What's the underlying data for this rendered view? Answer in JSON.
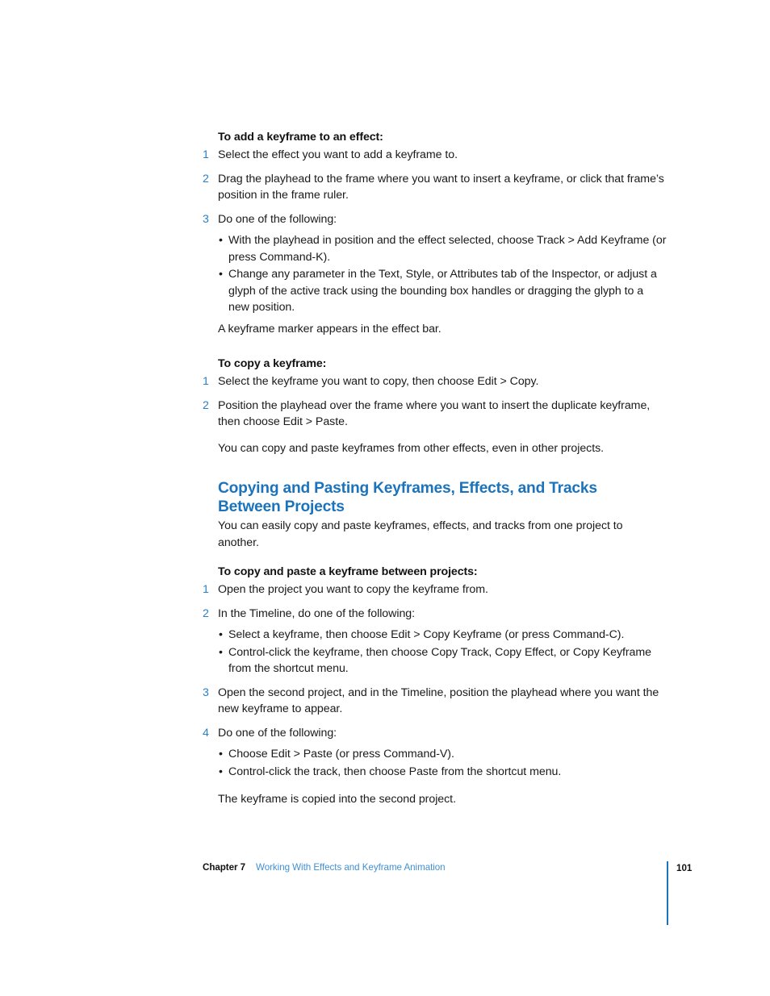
{
  "colors": {
    "heading_blue": "#1b73bb",
    "step_number_blue": "#2b7fc4",
    "footer_link_blue": "#3f90d6",
    "body_text": "#1a1a1a",
    "page_background": "#ffffff"
  },
  "sections": {
    "add_keyframe": {
      "heading": "To add a keyframe to an effect:",
      "steps": [
        {
          "number": "1",
          "text": "Select the effect you want to add a keyframe to."
        },
        {
          "number": "2",
          "text": "Drag the playhead to the frame where you want to insert a keyframe, or click that frame’s position in the frame ruler."
        },
        {
          "number": "3",
          "text": "Do one of the following:"
        }
      ],
      "bullets": [
        {
          "marker": "•",
          "text": "With the playhead in position and the effect selected, choose Track > Add Keyframe (or press Command-K)."
        },
        {
          "marker": "•",
          "text": "Change any parameter in the Text, Style, or Attributes tab of the Inspector, or adjust a glyph of the active track using the bounding box handles or dragging the glyph to a new position."
        }
      ],
      "closing_paragraph": "A keyframe marker appears in the effect bar."
    },
    "copy_keyframe": {
      "heading": "To copy a keyframe:",
      "steps": [
        {
          "number": "1",
          "text": "Select the keyframe you want to copy, then choose Edit > Copy."
        },
        {
          "number": "2",
          "text": "Position the playhead over the frame where you want to insert the duplicate keyframe, then choose Edit > Paste."
        }
      ],
      "closing_paragraph": "You can copy and paste keyframes from other effects, even in other projects."
    },
    "between_projects": {
      "heading_line_1": "Copying and Pasting Keyframes, Effects, and Tracks",
      "heading_line_2": "Between Projects",
      "intro_paragraph": "You can easily copy and paste keyframes, effects, and tracks from one project to another.",
      "procedure_heading": "To copy and paste a keyframe between projects:",
      "steps": [
        {
          "number": "1",
          "text": "Open the project you want to copy the keyframe from."
        },
        {
          "number": "2",
          "text": "In the Timeline, do one of the following:"
        },
        {
          "number": "3",
          "text": "Open the second project, and in the Timeline, position the playhead where you want the new keyframe to appear."
        },
        {
          "number": "4",
          "text": "Do one of the following:"
        }
      ],
      "bullets_step2": [
        {
          "marker": "•",
          "text": "Select a keyframe, then choose Edit > Copy Keyframe (or press Command-C)."
        },
        {
          "marker": "•",
          "text": "Control-click the keyframe, then choose Copy Track, Copy Effect, or Copy Keyframe from the shortcut menu."
        }
      ],
      "bullets_step4": [
        {
          "marker": "•",
          "text": "Choose Edit > Paste (or press Command-V)."
        },
        {
          "marker": "•",
          "text": "Control-click the track, then choose Paste from the shortcut menu."
        }
      ],
      "closing_paragraph": "The keyframe is copied into the second project."
    }
  },
  "footer": {
    "chapter_label": "Chapter 7",
    "chapter_title": "Working With Effects and Keyframe Animation",
    "page_number": "101"
  }
}
